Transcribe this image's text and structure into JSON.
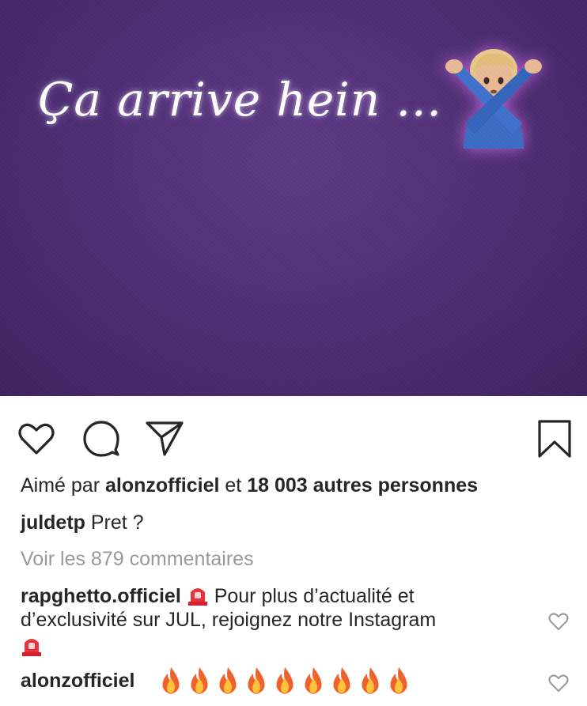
{
  "post": {
    "story_text": "Ça arrive hein ...",
    "emoji": "man-gesturing-no",
    "background_color": "#4f2f75"
  },
  "actions": {
    "like_icon": "heart-icon",
    "comment_icon": "comment-icon",
    "share_icon": "send-icon",
    "save_icon": "bookmark-icon"
  },
  "likes": {
    "prefix": "Aimé par ",
    "user": "alonzofficiel",
    "middle": " et ",
    "count_text": "18 003 autres personnes"
  },
  "caption": {
    "username": "juldetp",
    "text": " Pret ?"
  },
  "view_comments": "Voir les 879 commentaires",
  "comments": [
    {
      "username": "rapghetto.officiel",
      "line1": " Pour plus d’actualité et",
      "line2": "d’exclusivité sur JUL, rejoignez notre Instagram",
      "emoji": "police-light-icon"
    },
    {
      "username": "alonzofficiel",
      "emoji": "fire-icon",
      "emoji_count": 9
    }
  ]
}
